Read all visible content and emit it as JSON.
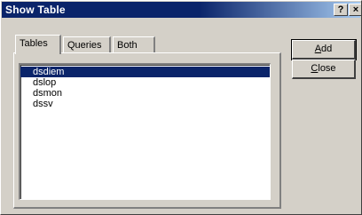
{
  "window": {
    "title": "Show Table",
    "help_label": "?",
    "close_label": "×"
  },
  "tabs": [
    {
      "label": "Tables",
      "active": true
    },
    {
      "label": "Queries",
      "active": false
    },
    {
      "label": "Both",
      "active": false
    }
  ],
  "list": {
    "items": [
      "dsdiem",
      "dslop",
      "dsmon",
      "dssv"
    ],
    "selected": "dsdiem"
  },
  "buttons": {
    "add_mnemonic": "A",
    "add_rest": "dd",
    "close_mnemonic": "C",
    "close_rest": "lose"
  }
}
